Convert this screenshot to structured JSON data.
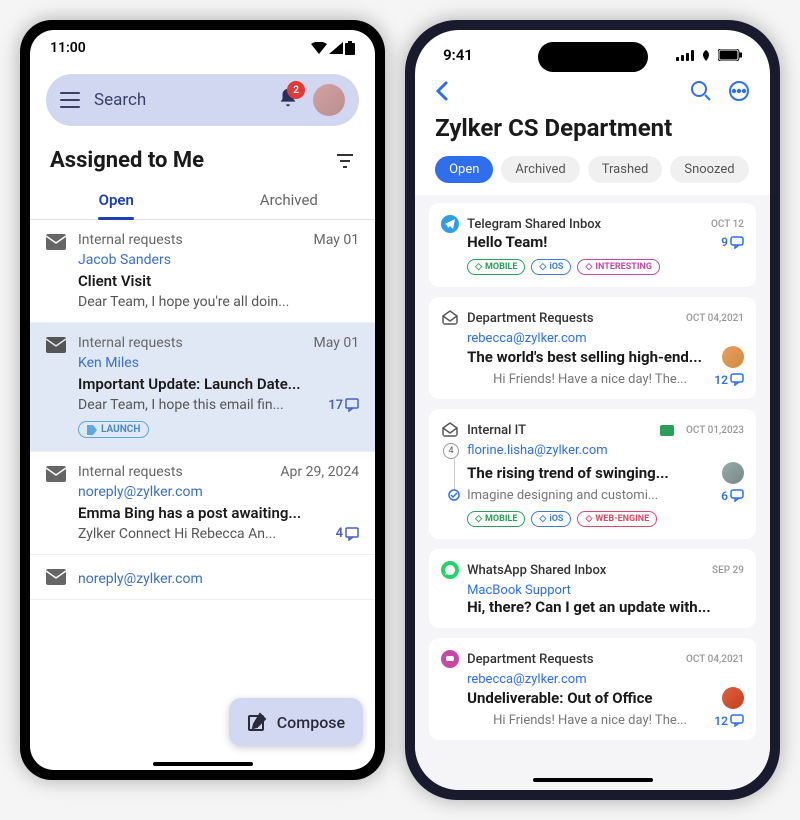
{
  "android": {
    "status_time": "11:00",
    "search_placeholder": "Search",
    "notification_count": "2",
    "page_title": "Assigned to Me",
    "tabs": {
      "open": "Open",
      "archived": "Archived"
    },
    "compose_label": "Compose",
    "emails": [
      {
        "category": "Internal requests",
        "date": "May 01",
        "sender": "Jacob Sanders",
        "subject": "Client Visit",
        "preview": "Dear Team, I hope you're all doin..."
      },
      {
        "category": "Internal requests",
        "date": "May 01",
        "sender": "Ken Miles",
        "subject": "Important Update: Launch Date...",
        "preview": "Dear Team,  I hope this email fin...",
        "count": "17",
        "tag": "LAUNCH"
      },
      {
        "category": "Internal requests",
        "date": "Apr 29, 2024",
        "sender": "noreply@zylker.com",
        "subject": "Emma Bing has a post awaiting...",
        "preview": "Zylker Connect Hi Rebecca An...",
        "count": "4"
      },
      {
        "sender": "noreply@zylker.com"
      }
    ]
  },
  "ios": {
    "status_time": "9:41",
    "page_title": "Zylker CS Department",
    "filters": {
      "open": "Open",
      "archived": "Archived",
      "trashed": "Trashed",
      "snoozed": "Snoozed"
    },
    "emails": [
      {
        "source": "Telegram Shared Inbox",
        "date": "OCT 12",
        "subject": "Hello Team!",
        "count": "9",
        "tags": [
          "MOBILE",
          "iOS",
          "INTERESTING"
        ]
      },
      {
        "source": "Department Requests",
        "date": "OCT 04,2021",
        "sender": "rebecca@zylker.com",
        "subject": "The world's best selling high-end...",
        "preview": "Hi Friends! Have a nice day! The...",
        "count": "12"
      },
      {
        "source": "Internal IT",
        "date": "OCT 01,2023",
        "sender": "florine.lisha@zylker.com",
        "thread": "4",
        "subject": "The rising trend of swinging...",
        "preview": "Imagine designing and customi...",
        "count": "6",
        "tags": [
          "MOBILE",
          "iOS",
          "WEB-ENGINE"
        ]
      },
      {
        "source": "WhatsApp Shared Inbox",
        "date": "SEP 29",
        "sender": "MacBook Support",
        "subject": "Hi, there? Can I get an update with..."
      },
      {
        "source": "Department Requests",
        "date": "OCT 04,2021",
        "sender": "rebecca@zylker.com",
        "subject": "Undeliverable: Out of Office",
        "preview": "Hi Friends! Have a nice day! The...",
        "count": "12"
      }
    ]
  }
}
